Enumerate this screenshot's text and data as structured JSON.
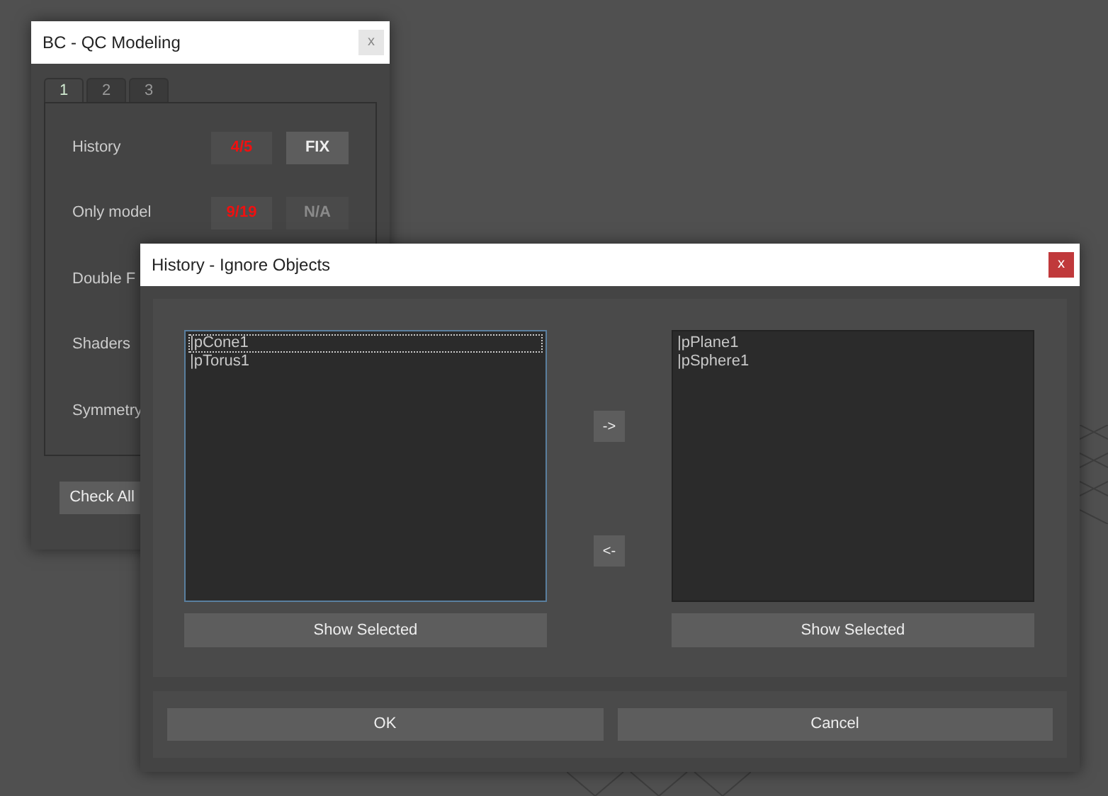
{
  "back_window": {
    "title": "BC - QC Modeling",
    "close": "x",
    "tabs": [
      {
        "label": "1",
        "selected": true
      },
      {
        "label": "2",
        "selected": false
      },
      {
        "label": "3",
        "selected": false
      }
    ],
    "checks": [
      {
        "label": "History",
        "result": "4/5",
        "action": "FIX",
        "action_disabled": false
      },
      {
        "label": "Only model",
        "result": "9/19",
        "action": "N/A",
        "action_disabled": true
      },
      {
        "label": "Double F"
      },
      {
        "label": "Shaders"
      },
      {
        "label": "Symmetry"
      }
    ],
    "check_all": "Check All"
  },
  "dialog": {
    "title": "History - Ignore Objects",
    "close": "x",
    "left_list": [
      {
        "label": "|pCone1",
        "selected": true
      },
      {
        "label": "|pTorus1",
        "selected": false
      }
    ],
    "right_list": [
      {
        "label": "|pPlane1",
        "selected": false
      },
      {
        "label": "|pSphere1",
        "selected": false
      }
    ],
    "move_right": "->",
    "move_left": "<-",
    "left_show": "Show Selected",
    "right_show": "Show Selected",
    "buttons": [
      "OK",
      "Cancel"
    ]
  }
}
